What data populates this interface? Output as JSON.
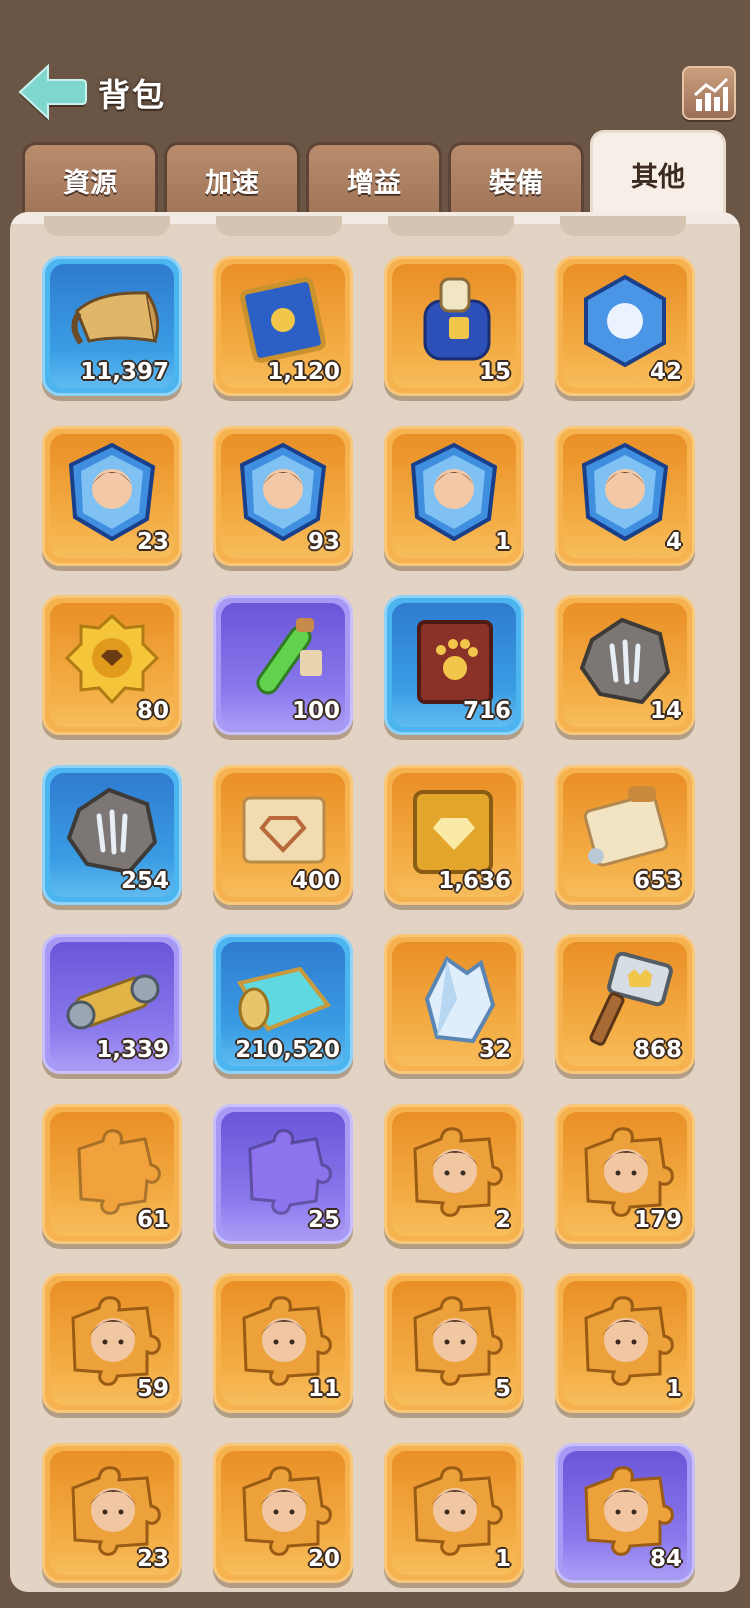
{
  "header": {
    "title": "背包",
    "back_icon": "arrow-left-icon",
    "stats_icon": "bar-chart-icon"
  },
  "tabs": [
    {
      "label": "資源",
      "active": false
    },
    {
      "label": "加速",
      "active": false
    },
    {
      "label": "增益",
      "active": false
    },
    {
      "label": "裝備",
      "active": false
    },
    {
      "label": "其他",
      "active": true
    }
  ],
  "colors": {
    "background": "#6b5646",
    "panel": "#e2d3c4",
    "tab_inactive": "#b98c6d",
    "tab_active": "#f6eee7",
    "rarity_orange": "#f4ad45",
    "rarity_blue": "#3a9de4",
    "rarity_purple": "#8a78ec"
  },
  "items": [
    {
      "icon": "horn-icon",
      "rarity": "blue",
      "count": "11,397"
    },
    {
      "icon": "blue-book-icon",
      "rarity": "orange",
      "count": "1,120"
    },
    {
      "icon": "backpack-scroll-icon",
      "rarity": "orange",
      "count": "15"
    },
    {
      "icon": "crystal-emblem-icon",
      "rarity": "orange",
      "count": "42"
    },
    {
      "icon": "hero-crystal-icon",
      "rarity": "orange",
      "count": "23"
    },
    {
      "icon": "hero-crystal-icon",
      "rarity": "orange",
      "count": "93"
    },
    {
      "icon": "hero-crystal-icon",
      "rarity": "orange",
      "count": "1"
    },
    {
      "icon": "hero-crystal-icon",
      "rarity": "orange",
      "count": "4"
    },
    {
      "icon": "beast-medal-icon",
      "rarity": "orange",
      "count": "80"
    },
    {
      "icon": "potion-vial-icon",
      "rarity": "purple",
      "count": "100"
    },
    {
      "icon": "paw-book-icon",
      "rarity": "blue",
      "count": "716"
    },
    {
      "icon": "claw-stone-icon",
      "rarity": "orange",
      "count": "14"
    },
    {
      "icon": "claw-stone-icon",
      "rarity": "blue",
      "count": "254"
    },
    {
      "icon": "diamond-scroll-icon",
      "rarity": "orange",
      "count": "400"
    },
    {
      "icon": "diamond-book-icon",
      "rarity": "orange",
      "count": "1,636"
    },
    {
      "icon": "map-scroll-icon",
      "rarity": "orange",
      "count": "653"
    },
    {
      "icon": "spool-icon",
      "rarity": "purple",
      "count": "1,339"
    },
    {
      "icon": "cloth-roll-icon",
      "rarity": "blue",
      "count": "210,520"
    },
    {
      "icon": "crystal-ore-icon",
      "rarity": "orange",
      "count": "32"
    },
    {
      "icon": "hammer-icon",
      "rarity": "orange",
      "count": "868"
    },
    {
      "icon": "puzzle-piece-icon",
      "rarity": "orange",
      "count": "61"
    },
    {
      "icon": "puzzle-piece-icon",
      "rarity": "purple",
      "count": "25"
    },
    {
      "icon": "hero-fragment-icon",
      "rarity": "orange",
      "count": "2"
    },
    {
      "icon": "hero-fragment-icon",
      "rarity": "orange",
      "count": "179"
    },
    {
      "icon": "hero-fragment-icon",
      "rarity": "orange",
      "count": "59"
    },
    {
      "icon": "hero-fragment-icon",
      "rarity": "orange",
      "count": "11"
    },
    {
      "icon": "hero-fragment-icon",
      "rarity": "orange",
      "count": "5"
    },
    {
      "icon": "hero-fragment-icon",
      "rarity": "orange",
      "count": "1"
    },
    {
      "icon": "hero-fragment-icon",
      "rarity": "orange",
      "count": "23"
    },
    {
      "icon": "hero-fragment-icon",
      "rarity": "orange",
      "count": "20"
    },
    {
      "icon": "hero-fragment-icon",
      "rarity": "orange",
      "count": "1"
    },
    {
      "icon": "hero-fragment-icon",
      "rarity": "purple",
      "count": "84"
    }
  ]
}
